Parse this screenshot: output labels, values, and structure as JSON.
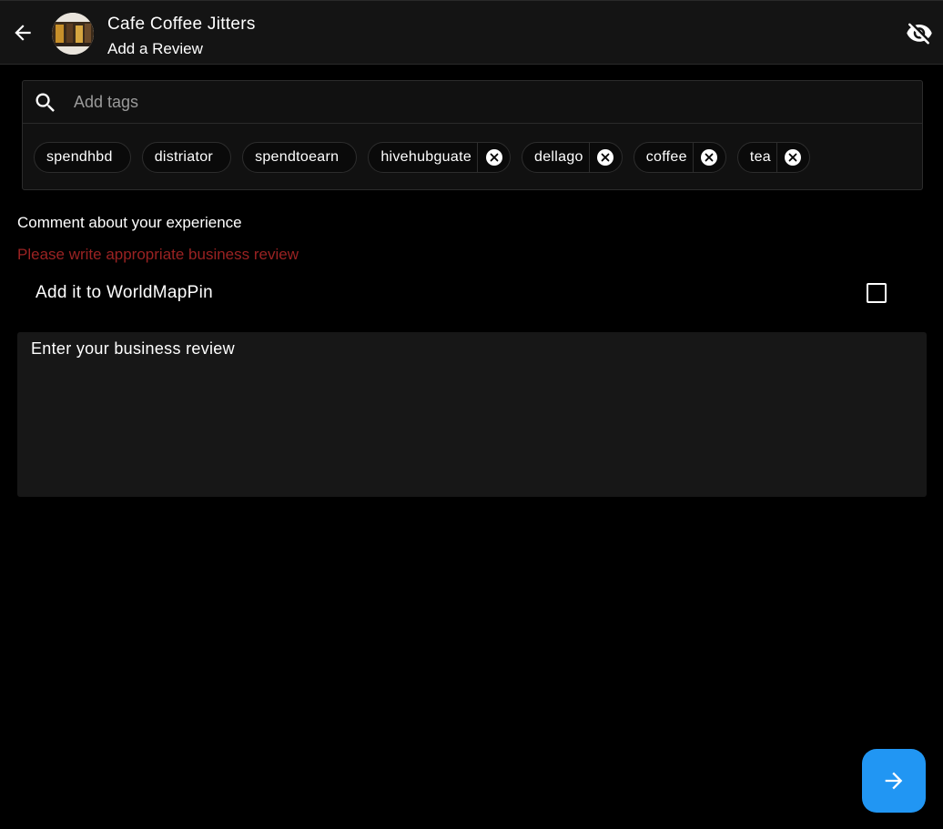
{
  "header": {
    "title": "Cafe Coffee Jitters",
    "subtitle": "Add a Review",
    "icons": {
      "back": "arrow-left-icon",
      "visibility": "visibility-off-icon"
    }
  },
  "tags": {
    "placeholder": "Add tags",
    "items": [
      {
        "label": "spendhbd",
        "removable": false
      },
      {
        "label": "distriator",
        "removable": false
      },
      {
        "label": "spendtoearn",
        "removable": false
      },
      {
        "label": "hivehubguate",
        "removable": true
      },
      {
        "label": "dellago",
        "removable": true
      },
      {
        "label": "coffee",
        "removable": true
      },
      {
        "label": "tea",
        "removable": true
      }
    ]
  },
  "form": {
    "comment_label": "Comment about your experience",
    "warning": "Please write appropriate business review",
    "worldmappin_label": "Add it to WorldMapPin",
    "worldmappin_checked": false,
    "review_placeholder": "Enter your business review",
    "review_value": ""
  },
  "colors": {
    "accent": "#2196f3",
    "warning": "#9a2222",
    "background": "#000000",
    "appbar": "#141414"
  }
}
